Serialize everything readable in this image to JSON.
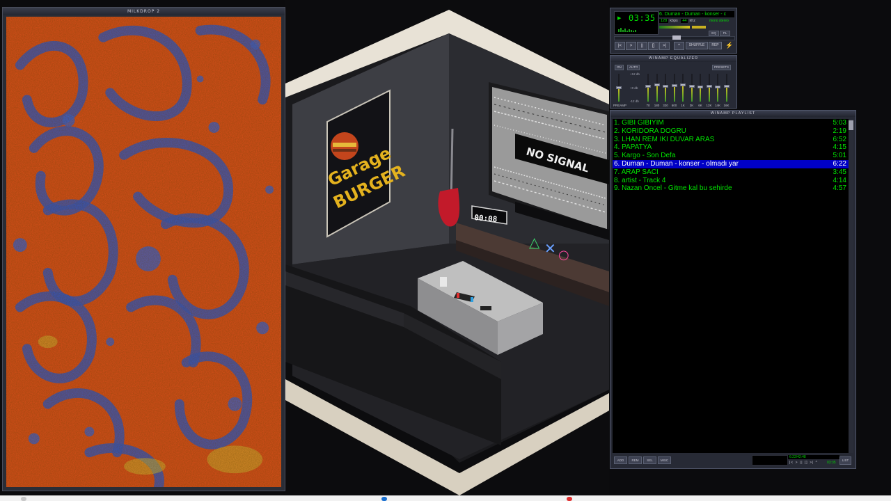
{
  "milkdrop": {
    "title": "MILKDROP 2"
  },
  "scene": {
    "tv_text": "NO SIGNAL",
    "poster_line1": "Garage",
    "poster_line2": "BURGER",
    "clock_text": "00:08"
  },
  "player": {
    "time": "03:35",
    "marquee": "6. Duman - Duman  - konser - c",
    "kbps": "128",
    "kbps_label": "kbps",
    "khz": "44",
    "khz_label": "khz",
    "mono_stereo": "mono  stereo",
    "eq_button": "EQ",
    "pl_button": "PL",
    "transport": [
      "|<",
      ">",
      "||",
      "[]",
      ">|"
    ],
    "eject": "^",
    "shuffle": "SHUFFLE",
    "repeat": "REP",
    "colors": {
      "lcd_green": "#00e000",
      "frame": "#272a35"
    }
  },
  "equalizer": {
    "title": "WINAMP EQUALIZER",
    "on": "ON",
    "auto": "AUTO",
    "presets": "PRESETS",
    "db_top": "+12 db",
    "db_mid": "+0 db",
    "db_bottom": "-12 db",
    "preamp_label": "PREAMP",
    "bands": [
      {
        "label": "70",
        "level": 0.55
      },
      {
        "label": "180",
        "level": 0.62
      },
      {
        "label": "320",
        "level": 0.55
      },
      {
        "label": "600",
        "level": 0.58
      },
      {
        "label": "1K",
        "level": 0.6
      },
      {
        "label": "3K",
        "level": 0.55
      },
      {
        "label": "6K",
        "level": 0.52
      },
      {
        "label": "12K",
        "level": 0.56
      },
      {
        "label": "14K",
        "level": 0.54
      },
      {
        "label": "16K",
        "level": 0.55
      }
    ],
    "preamp_level": 0.5
  },
  "playlist": {
    "title": "WINAMP PLAYLIST",
    "items": [
      {
        "title": "1. GİBİ GİBİYİM",
        "duration": "5:03"
      },
      {
        "title": "2. KORIDORA DOGRU",
        "duration": "2:19"
      },
      {
        "title": "3.  LHAN  REM   IKI DUVAR ARAS",
        "duration": "6:52"
      },
      {
        "title": "4. PAPATYA",
        "duration": "4:15"
      },
      {
        "title": "5. Kargo - Son Defa",
        "duration": "5:01"
      },
      {
        "title": "6. Duman - Duman  - konser - olmadı yar",
        "duration": "6:22"
      },
      {
        "title": "7. ARAP SACI",
        "duration": "3:45"
      },
      {
        "title": "8. artist - Track 4",
        "duration": "4:14"
      },
      {
        "title": "9. Nazan Oncel - Gitme kal bu sehirde",
        "duration": "4:57"
      }
    ],
    "selected_index": 5,
    "buttons": {
      "add": "ADD",
      "rem": "REM",
      "sel": "SEL",
      "misc": "MISC",
      "list": "LIST"
    },
    "info_text": "6:22/42:48",
    "mini_controls": "|< > || [] >| ^",
    "mini_time": "03:35",
    "colors": {
      "text": "#00e400",
      "selected_bg": "#0000c6"
    }
  }
}
